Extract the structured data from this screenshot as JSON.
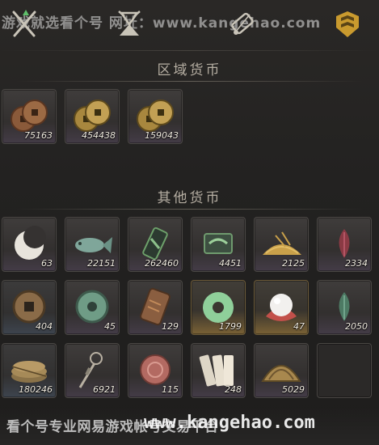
{
  "watermark": {
    "top": "游戏就选看个号 网址：www.kangehao.com",
    "bottom_text": "看个号专业网易游戏帐号交易平台",
    "bottom_url": "www.kangehao.com"
  },
  "top_tabs": [
    {
      "icon": "crossed-swords-icon"
    },
    {
      "icon": "hourglass-icon"
    },
    {
      "icon": "scroll-icon"
    },
    {
      "icon": "currency-tab-icon"
    }
  ],
  "regional_currency": {
    "title": "区域货币",
    "items": [
      {
        "icon": "bronze-coins-icon",
        "qty": "75163"
      },
      {
        "icon": "gold-coins-icon",
        "qty": "454438"
      },
      {
        "icon": "gold-coins-icon",
        "qty": "159043"
      }
    ]
  },
  "other_currency": {
    "title": "其他货币",
    "items": [
      {
        "icon": "crescent-moon-icon",
        "qty": "63",
        "rarity": "purple"
      },
      {
        "icon": "jade-fish-icon",
        "qty": "22151",
        "rarity": "purple"
      },
      {
        "icon": "jade-token-icon",
        "qty": "262460",
        "rarity": "purple"
      },
      {
        "icon": "jade-tile-icon",
        "qty": "4451",
        "rarity": "purple"
      },
      {
        "icon": "grain-pile-icon",
        "qty": "2125",
        "rarity": "purple"
      },
      {
        "icon": "red-leaf-icon",
        "qty": "2334",
        "rarity": "purple"
      },
      {
        "icon": "square-hole-coin-icon",
        "qty": "404",
        "rarity": "blue"
      },
      {
        "icon": "jade-coin-icon",
        "qty": "45",
        "rarity": "purple"
      },
      {
        "icon": "bronze-tablet-icon",
        "qty": "129",
        "rarity": "purple"
      },
      {
        "icon": "jade-ring-icon",
        "qty": "1799",
        "rarity": "gold"
      },
      {
        "icon": "pearl-icon",
        "qty": "47",
        "rarity": "gold"
      },
      {
        "icon": "green-leaf-icon",
        "qty": "2050",
        "rarity": "purple"
      },
      {
        "icon": "coin-string-icon",
        "qty": "180246",
        "rarity": "blue"
      },
      {
        "icon": "coin-sword-icon",
        "qty": "6921",
        "rarity": "purple"
      },
      {
        "icon": "red-disc-icon",
        "qty": "115",
        "rarity": "purple"
      },
      {
        "icon": "paper-notes-icon",
        "qty": "248",
        "rarity": "purple"
      },
      {
        "icon": "bronze-arch-icon",
        "qty": "5029",
        "rarity": "purple"
      },
      {
        "icon": "empty-slot",
        "qty": "",
        "rarity": "none"
      }
    ]
  }
}
